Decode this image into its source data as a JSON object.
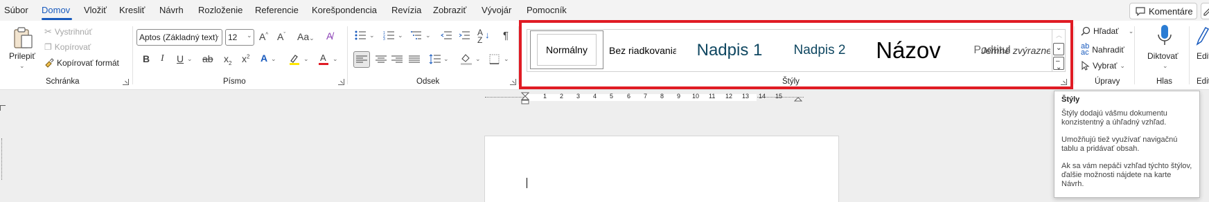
{
  "menu": {
    "items": [
      "Súbor",
      "Domov",
      "Vložiť",
      "Kresliť",
      "Návrh",
      "Rozloženie",
      "Referencie",
      "Korešpondencia",
      "Revízia",
      "Zobraziť",
      "Vývojár",
      "Pomocník"
    ],
    "active": "Domov",
    "comments_label": "Komentáre"
  },
  "clipboard": {
    "paste_label": "Prilepiť",
    "cut_label": "Vystrihnúť",
    "copy_label": "Kopírovať",
    "format_painter_label": "Kopírovať formát",
    "group_label": "Schránka"
  },
  "font": {
    "font_name": "Aptos (Základný text)",
    "font_size": "12",
    "group_label": "Písmo",
    "highlight_color": "#ffe600",
    "font_color": "#e01b24"
  },
  "paragraph": {
    "group_label": "Odsek"
  },
  "styles": {
    "tiles": [
      "Normálny",
      "Bez riadkovania",
      "Nadpis 1",
      "Nadpis 2",
      "Názov",
      "Podtitul",
      "Jemné zvýraznenie"
    ],
    "group_label": "Štýly"
  },
  "editing": {
    "find_label": "Hľadať",
    "replace_label": "Nahradiť",
    "select_label": "Vybrať",
    "group_label": "Úpravy"
  },
  "voice": {
    "dictate_label": "Diktovať",
    "group_label": "Hlas"
  },
  "editor": {
    "label": "Edit",
    "group_label": "Edit"
  },
  "ruler": {
    "numbers": [
      "1",
      "2",
      "3",
      "4",
      "5",
      "6",
      "7",
      "8",
      "9",
      "10",
      "11",
      "12",
      "13",
      "14",
      "15"
    ]
  },
  "tooltip": {
    "title": "Štýly",
    "paragraphs": [
      "Štýly dodajú vášmu dokumentu konzistentný a úhľadný vzhľad.",
      "Umožňujú tiež využívať navigačnú tablu a pridávať obsah.",
      "Ak sa vám nepáči vzhľad týchto štýlov, ďalšie možnosti nájdete na karte Návrh."
    ]
  },
  "colors": {
    "accent": "#185abd",
    "highlight_border": "#e01b24"
  }
}
